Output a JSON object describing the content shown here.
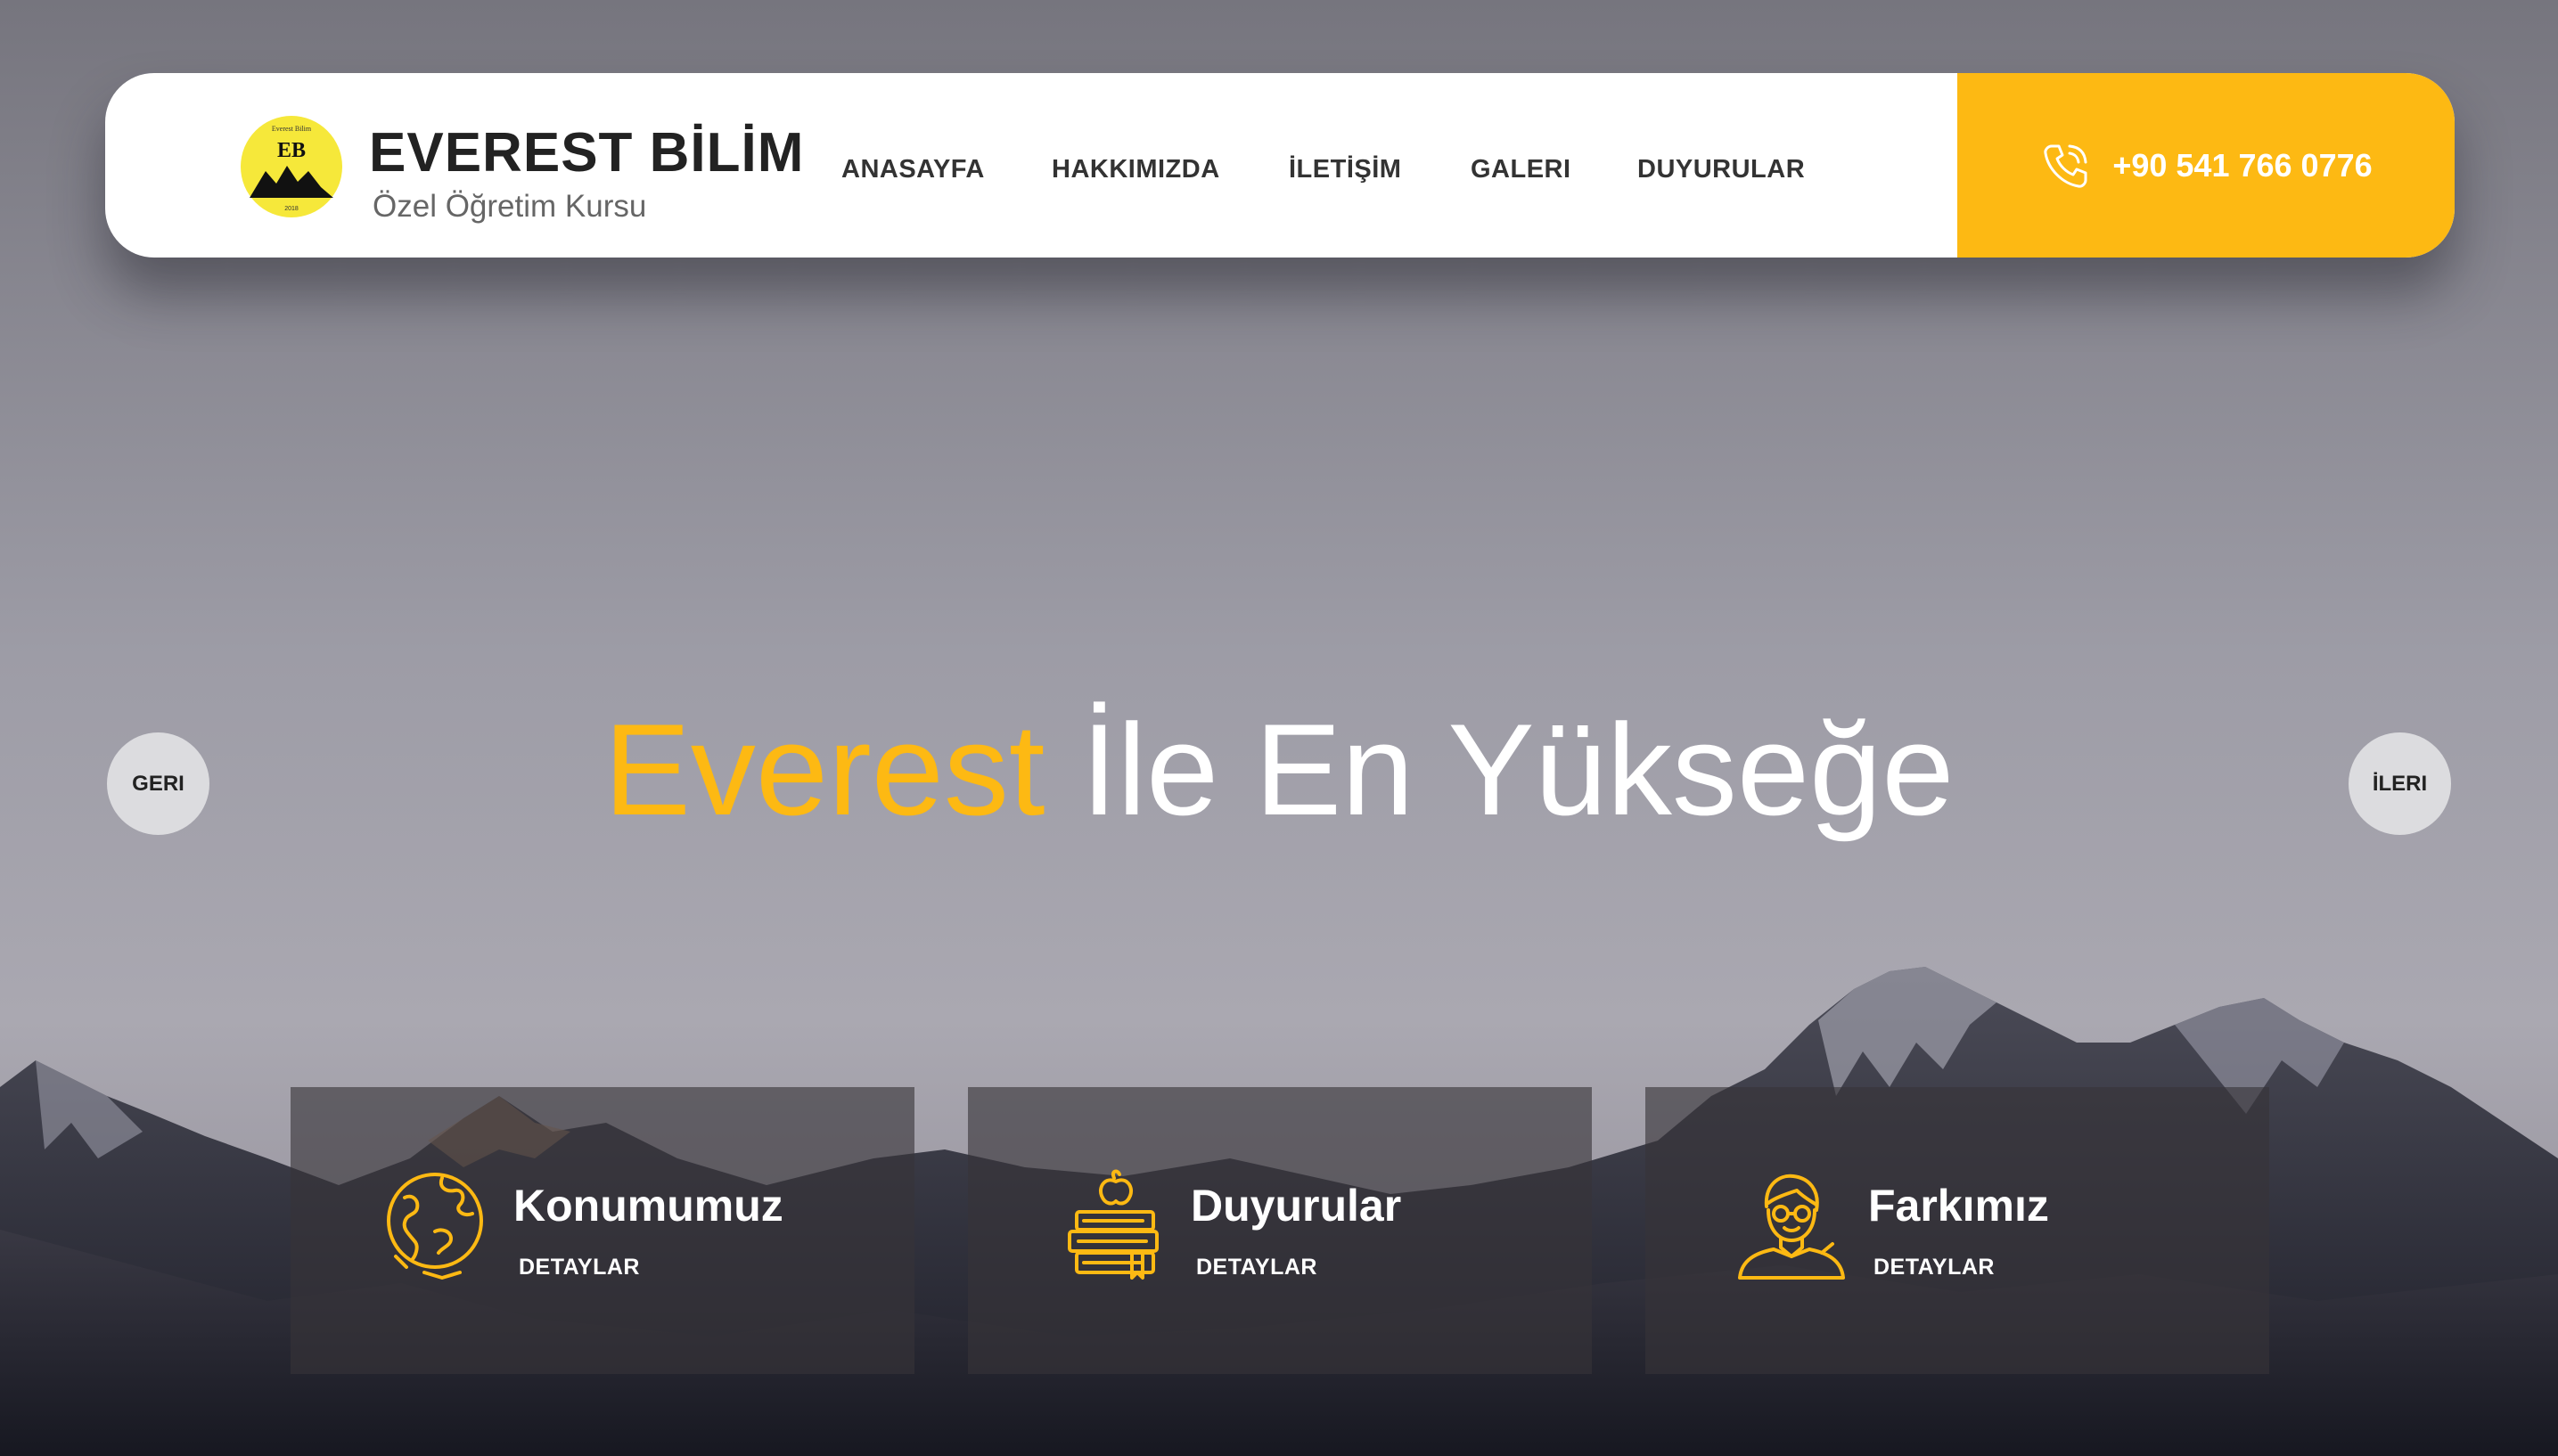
{
  "brand": {
    "name": "EVEREST BİLİM",
    "tagline": "Özel Öğretim Kursu",
    "logo_text_top": "Everest Bilim",
    "logo_initials": "EB",
    "logo_year": "2018"
  },
  "nav": {
    "items": [
      {
        "label": "ANASAYFA"
      },
      {
        "label": "HAKKIMIZDA"
      },
      {
        "label": "İLETİŞİM"
      },
      {
        "label": "GALERI"
      },
      {
        "label": "DUYURULAR"
      }
    ]
  },
  "contact": {
    "phone": "+90 541 766 0776",
    "icon": "phone-ringing-icon"
  },
  "slider": {
    "prev_label": "GERI",
    "next_label": "İLERI",
    "headline_accent": "Everest",
    "headline_rest": " İle En Yükseğe"
  },
  "cards": [
    {
      "title": "Konumumuz",
      "link": "DETAYLAR",
      "icon": "globe-icon"
    },
    {
      "title": "Duyurular",
      "link": "DETAYLAR",
      "icon": "books-apple-icon"
    },
    {
      "title": "Farkımız",
      "link": "DETAYLAR",
      "icon": "teacher-icon"
    }
  ],
  "colors": {
    "accent": "#fdb913",
    "nav_text": "#333333",
    "card_bg": "rgba(55,52,56,0.62)"
  }
}
